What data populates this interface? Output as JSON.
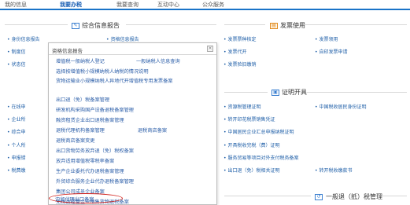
{
  "topnav": {
    "tabs": [
      {
        "label": "我的信息",
        "active": false
      },
      {
        "label": "我要办税",
        "active": true
      },
      {
        "label": "我要查询",
        "active": false
      },
      {
        "label": "互动中心",
        "active": false
      },
      {
        "label": "公众服务",
        "active": false
      }
    ]
  },
  "sections": {
    "comprehensive": {
      "title": "综合信息报告",
      "icon": "edit-icon"
    },
    "invoice": {
      "title": "发票使用",
      "icon": "invoice-icon"
    },
    "certificate": {
      "title": "证明开具",
      "icon": "certificate-icon"
    },
    "general": {
      "title": "一般退（抵）税管理",
      "icon": "refund-icon"
    }
  },
  "left_links": [
    "身份信息报告",
    "制度信",
    "状态信",
    "在线申",
    "企业所",
    "综合申",
    "个人所",
    "申报错",
    "税费缴"
  ],
  "mid_top_links": [
    "资格信息报告",
    "资源税管理报告"
  ],
  "invoice_links": [
    "发票票种核定",
    "发票领用",
    "发票代开",
    "自印发票申请",
    "发票验旧缴销"
  ],
  "certificate_links": [
    "资源税管理证明",
    "中国税收居民身份证明",
    "转开印花税票销售凭证",
    "中国居民企业汇总申报纳税证明",
    "开具税收完税（费）证明",
    "服务贸易等项目对外支付税务备案",
    "出口退（免）税相关证明",
    "转开税收缴款书"
  ],
  "panel": {
    "title": "资格信息报告",
    "close": "×",
    "items": [
      "增值税一般纳税人登记",
      "一般纳税人信息查询",
      "选择按增值税小规模纳税人纳税的情况说明",
      "货物运输业小规模纳税人异地代开增值税专用发票备案",
      "出口退（免）税备案管理",
      "研发机构采购国产设备退税备案管理",
      "融资租赁企业出口退税备案管理",
      "退税代理机构备案管理",
      "退税商店备案",
      "退税商店备案变更",
      "出口货物劳务放弃退（免）税权备案",
      "放弃适用增值税零税率备案",
      "生产企业委托代办退税备案管理",
      "外贸综合服务企业代办退税备案管理",
      "集团公司成员企业备案",
      "免税品经营企业销售货物退税备案",
      "边贸代理出口备案"
    ]
  }
}
